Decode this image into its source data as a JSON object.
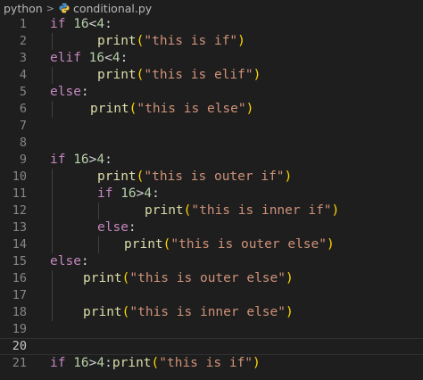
{
  "breadcrumb": {
    "folder": "python",
    "file": "conditional.py"
  },
  "editor": {
    "current_line": 20,
    "lines": [
      {
        "n": "1",
        "indent": 0,
        "code": "if 16<4:"
      },
      {
        "n": "2",
        "indent": 1,
        "code": "print(\"this is if\")"
      },
      {
        "n": "3",
        "indent": 0,
        "code": "elif 16<4:"
      },
      {
        "n": "4",
        "indent": 1,
        "code": "print(\"this is elif\")"
      },
      {
        "n": "5",
        "indent": 0,
        "code": "else:"
      },
      {
        "n": "6",
        "indent": 2,
        "code": "print(\"this is else\")"
      },
      {
        "n": "7",
        "indent": 0,
        "code": ""
      },
      {
        "n": "8",
        "indent": 0,
        "code": ""
      },
      {
        "n": "9",
        "indent": 0,
        "code": "if 16>4:"
      },
      {
        "n": "10",
        "indent": 1,
        "code": "print(\"this is outer if\")"
      },
      {
        "n": "11",
        "indent": 1,
        "code": "if 16>4:"
      },
      {
        "n": "12",
        "indent": 3,
        "code": "print(\"this is inner if\")"
      },
      {
        "n": "13",
        "indent": 1,
        "code": "else:"
      },
      {
        "n": "14",
        "indent": 4,
        "code": "print(\"this is outer else\")"
      },
      {
        "n": "15",
        "indent": 0,
        "code": "else:"
      },
      {
        "n": "16",
        "indent": 5,
        "code": "print(\"this is outer else\")"
      },
      {
        "n": "17",
        "indent": 0,
        "code": ""
      },
      {
        "n": "18",
        "indent": 5,
        "code": "print(\"this is inner else\")"
      },
      {
        "n": "19",
        "indent": 0,
        "code": ""
      },
      {
        "n": "20",
        "indent": 0,
        "code": ""
      },
      {
        "n": "21",
        "indent": 0,
        "code": "if 16>4:print(\"this is if\")"
      }
    ]
  },
  "colors": {
    "keyword": "#c586c0",
    "number": "#b5cea8",
    "function": "#dcdcaa",
    "string": "#ce9178",
    "bracket": "#ffd700",
    "background": "#1e1e1e"
  },
  "icons": {
    "file": "python-file-icon",
    "separator": "chevron-right-icon"
  }
}
